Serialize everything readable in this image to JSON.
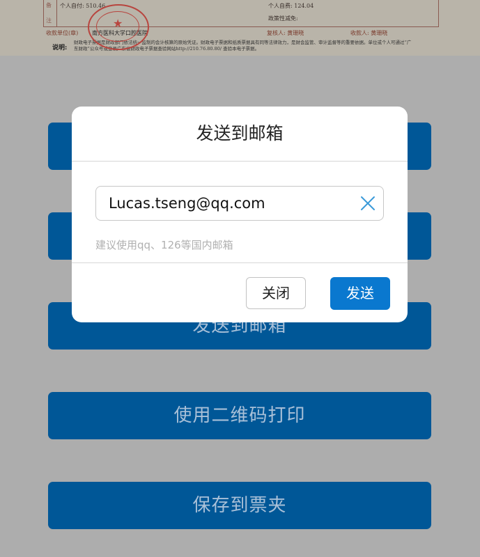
{
  "receipt": {
    "side_chars": [
      "备",
      "注"
    ],
    "personal_self_pay": "个人自付: 510.46",
    "personal_account": "个人自费: 124.04",
    "policy_reduction": "政策性减免:",
    "payee_unit": "收款单位(章)",
    "hospital": "南方医科大学口腔医院",
    "reviewer": "复核人: 黄珊晓",
    "cashier": "收款人: 黄珊晓",
    "note_label": "说明:",
    "note_text": "财政电子票据是财政部门依法统一监制的会计核算的原始凭证。财政电子票据和纸质票据具有同等法律效力，是财会监管、审计监督等的重要依据。单位或个人可通过“广东财政”公众号或登录广东省财政电子票据查验网站http://210.76.80.80/ 查验本电子票据。",
    "stamp_label": "南方医科大学口腔医院 财务专用章"
  },
  "buttons": {
    "b1": "",
    "b2": "",
    "b3": "发送到邮箱",
    "b4": "使用二维码打印",
    "b5": "保存到票夹"
  },
  "modal": {
    "title": "发送到邮箱",
    "email_value": "Lucas.tseng@qq.com",
    "hint": "建议使用qq、126等国内邮箱",
    "close_label": "关闭",
    "send_label": "发送",
    "clear_icon": "close-x-icon"
  },
  "colors": {
    "overlay": "#adadad",
    "button_blue": "#005797",
    "send_blue": "#0a78cf",
    "clear_icon": "#3a9ad9"
  }
}
